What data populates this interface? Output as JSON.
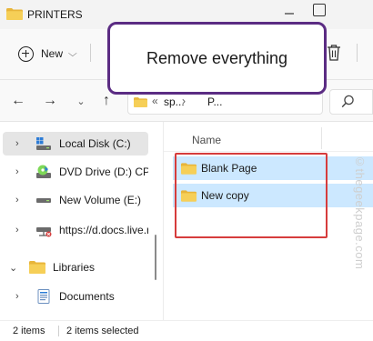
{
  "window": {
    "title": "PRINTERS"
  },
  "toolbar": {
    "new_label": "New",
    "new_chevron": "⌵",
    "delete_icon": "trash-icon"
  },
  "callout": {
    "text": "Remove everything"
  },
  "address": {
    "separator1": "«",
    "segment1": "sp...",
    "separator2": "›",
    "segment2": "P..."
  },
  "nav": {
    "back": "←",
    "forward": "→",
    "recent": "⌄",
    "up": "↑"
  },
  "sidebar": {
    "items": [
      {
        "label": "Local Disk (C:)",
        "chevron": "›",
        "icon": "drive-icon",
        "selected": true
      },
      {
        "label": "DVD Drive (D:) CPR",
        "chevron": "›",
        "icon": "dvd-icon",
        "selected": false
      },
      {
        "label": "New Volume (E:)",
        "chevron": "›",
        "icon": "drive-icon",
        "selected": false
      },
      {
        "label": "https://d.docs.live.n",
        "chevron": "›",
        "icon": "network-drive-icon",
        "selected": false
      },
      {
        "label": "Libraries",
        "chevron": "⌄",
        "icon": "folder-icon",
        "selected": false
      },
      {
        "label": "Documents",
        "chevron": "›",
        "icon": "documents-icon",
        "selected": false
      }
    ]
  },
  "content": {
    "column_name": "Name",
    "files": [
      {
        "name": "Blank Page",
        "icon": "folder-icon"
      },
      {
        "name": "New copy",
        "icon": "folder-icon"
      }
    ]
  },
  "status": {
    "item_count": "2 items",
    "selected_count": "2 items selected"
  },
  "watermark": "©thegeekpage.com",
  "colors": {
    "callout_border": "#5b2c83",
    "highlight_border": "#d63c3c",
    "selection": "#cce8ff",
    "folder": "#f2c94c"
  }
}
